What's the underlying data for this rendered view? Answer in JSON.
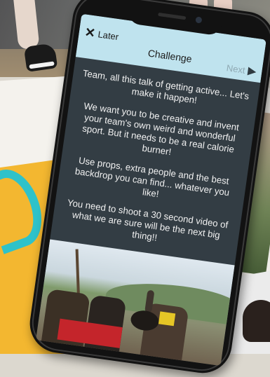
{
  "header": {
    "later_label": "Later",
    "title": "Challenge",
    "next_label": "Next"
  },
  "challenge": {
    "paragraphs": [
      "Team, all this talk of getting active... Let's make it happen!",
      "We want you to be creative and invent your team's own weird and wonderful sport. But it needs to be a real calorie burner!",
      "Use props, extra people and the best backdrop you can find... whatever you like!",
      "You need to shoot a 30 second video of what we are sure will be the next big thing!!"
    ]
  },
  "icons": {
    "later": "close-icon",
    "next": "arrow-right-icon"
  },
  "colors": {
    "header_bg": "#bfe3ee",
    "screen_bg": "#333d44",
    "accent_yellow": "#f3b730",
    "accent_teal": "#2fc2c9"
  }
}
